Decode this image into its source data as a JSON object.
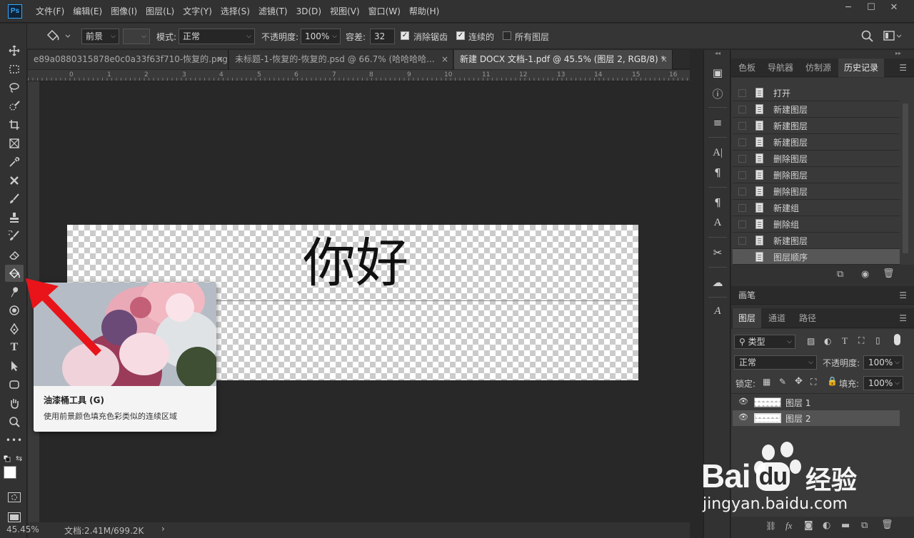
{
  "app": {
    "logo": "Ps"
  },
  "menu": [
    "文件(F)",
    "编辑(E)",
    "图像(I)",
    "图层(L)",
    "文字(Y)",
    "选择(S)",
    "滤镜(T)",
    "3D(D)",
    "视图(V)",
    "窗口(W)",
    "帮助(H)"
  ],
  "window_controls": {
    "minimize": "─",
    "maximize": "☐",
    "close": "✕"
  },
  "options": {
    "fill_source": "前景",
    "mode_label": "模式:",
    "mode_value": "正常",
    "opacity_label": "不透明度:",
    "opacity_value": "100%",
    "tolerance_label": "容差:",
    "tolerance_value": "32",
    "antialias_label": "消除锯齿",
    "contiguous_label": "连续的",
    "all_layers_label": "所有图层"
  },
  "tabs": [
    {
      "label": "e89a0880315878e0c0a33f63f710-恢复的.png ...",
      "close": "×"
    },
    {
      "label": "未标题-1-恢复的-恢复的.psd @ 66.7% (哈哈哈哈...",
      "close": "×"
    },
    {
      "label": "新建 DOCX 文档-1.pdf @ 45.5% (图层 2, RGB/8) *",
      "close": "×"
    }
  ],
  "ruler_ticks": [
    "0",
    "1",
    "2",
    "3",
    "4",
    "5",
    "6",
    "7",
    "8",
    "9",
    "10",
    "11",
    "12",
    "13",
    "14",
    "15",
    "16"
  ],
  "canvas": {
    "text": "你好"
  },
  "tooltip": {
    "title": "油漆桶工具 (G)",
    "description": "使用前景颜色填充色彩类似的连续区域"
  },
  "status": {
    "zoom": "45.45%",
    "doc_info": "文档:2.41M/699.2K",
    "arrow": "›"
  },
  "history_panel": {
    "tabs": [
      "色板",
      "导航器",
      "仿制源",
      "历史记录"
    ],
    "items": [
      "打开",
      "新建图层",
      "新建图层",
      "新建图层",
      "删除图层",
      "删除图层",
      "删除图层",
      "新建组",
      "删除组",
      "新建图层",
      "图层顺序"
    ]
  },
  "brush_panel": {
    "title": "画笔"
  },
  "layers_panel": {
    "tabs": [
      "图层",
      "通道",
      "路径"
    ],
    "filter_label": "类型",
    "blend_mode": "正常",
    "opacity_label": "不透明度:",
    "opacity_value": "100%",
    "lock_label": "锁定:",
    "fill_label": "填充:",
    "fill_value": "100%",
    "layers": [
      "图层 1",
      "图层 2"
    ],
    "bottom_icons": [
      "⛓",
      "fx"
    ]
  },
  "watermark": {
    "brand": "Bai",
    "brand_du": "du",
    "cn": "经验",
    "url": "jingyan.baidu.com"
  },
  "colors": {
    "accent_red": "#e8141a",
    "ps_blue": "#31a8ff",
    "baidu_white": "#ffffff"
  },
  "icons": [
    "move-icon",
    "marquee-icon",
    "lasso-icon",
    "quick-select-icon",
    "crop-icon",
    "frame-icon",
    "eyedropper-icon",
    "healing-icon",
    "brush-icon",
    "stamp-icon",
    "history-brush-icon",
    "eraser-icon",
    "paint-bucket-icon",
    "smudge-icon",
    "dodge-icon",
    "pen-icon",
    "type-icon",
    "path-select-icon",
    "shape-icon",
    "hand-icon",
    "zoom-icon",
    "more-icon"
  ]
}
